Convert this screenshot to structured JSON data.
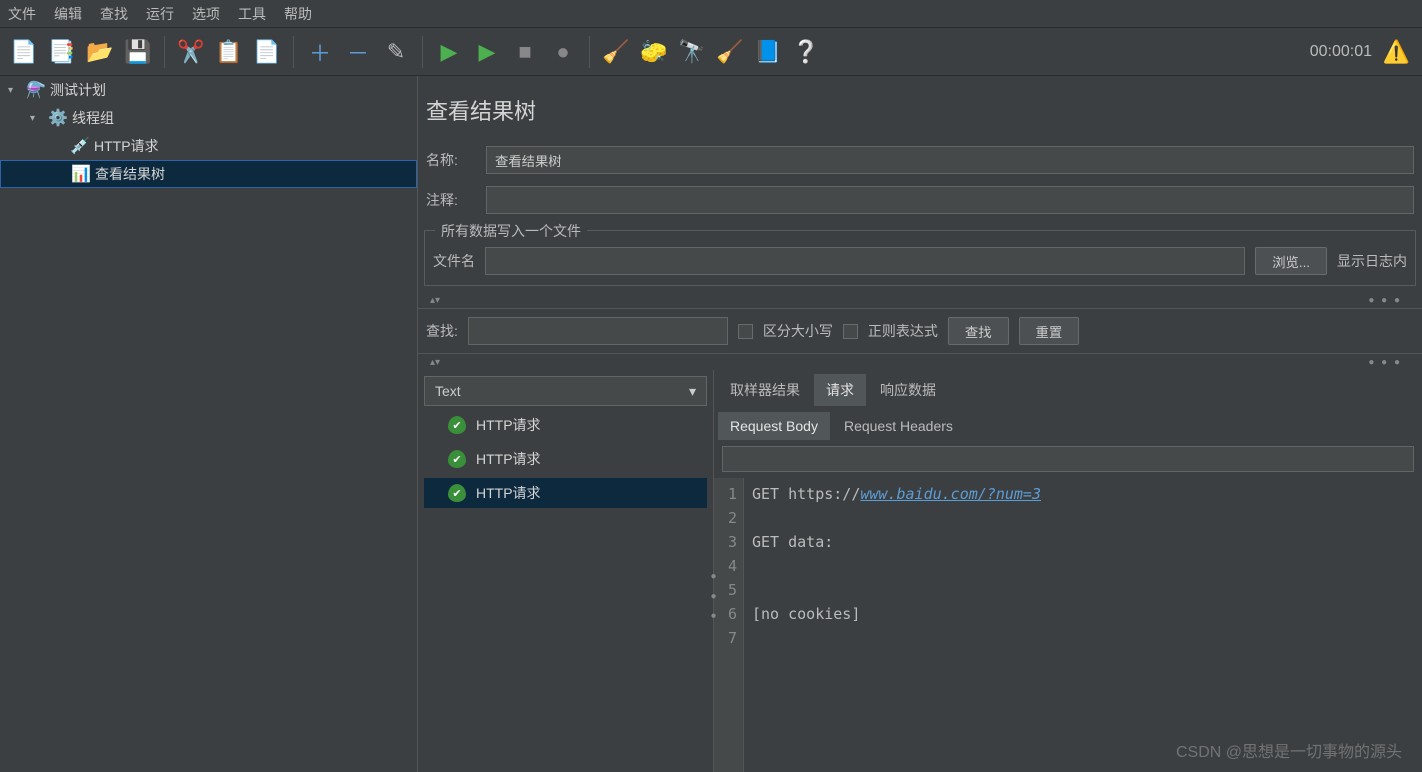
{
  "menubar": [
    "文件",
    "编辑",
    "查找",
    "运行",
    "选项",
    "工具",
    "帮助"
  ],
  "timer": "00:00:01",
  "tree": {
    "testplan": "测试计划",
    "threadgroup": "线程组",
    "httpreq": "HTTP请求",
    "viewresults": "查看结果树"
  },
  "panel": {
    "title": "查看结果树",
    "name_lbl": "名称:",
    "name_val": "查看结果树",
    "comment_lbl": "注释:",
    "group_label": "所有数据写入一个文件",
    "filename_lbl": "文件名",
    "browse_btn": "浏览...",
    "showlog_lbl": "显示日志内"
  },
  "search": {
    "lbl": "查找:",
    "case_lbl": "区分大小写",
    "regex_lbl": "正则表达式",
    "search_btn": "查找",
    "reset_btn": "重置"
  },
  "results": {
    "dropdown": "Text",
    "items": [
      "HTTP请求",
      "HTTP请求",
      "HTTP请求"
    ],
    "selected_idx": 2
  },
  "tabs": {
    "main": [
      "取样器结果",
      "请求",
      "响应数据"
    ],
    "main_active": 1,
    "sub": [
      "Request Body",
      "Request Headers"
    ],
    "sub_active": 0
  },
  "code": {
    "line1_prefix": "GET https://",
    "line1_url": "www.baidu.com/?num=3",
    "line3": "GET data:",
    "line6": "[no cookies]",
    "line_numbers": [
      "1",
      "2",
      "3",
      "4",
      "5",
      "6",
      "7"
    ]
  },
  "watermark": "CSDN @思想是一切事物的源头"
}
